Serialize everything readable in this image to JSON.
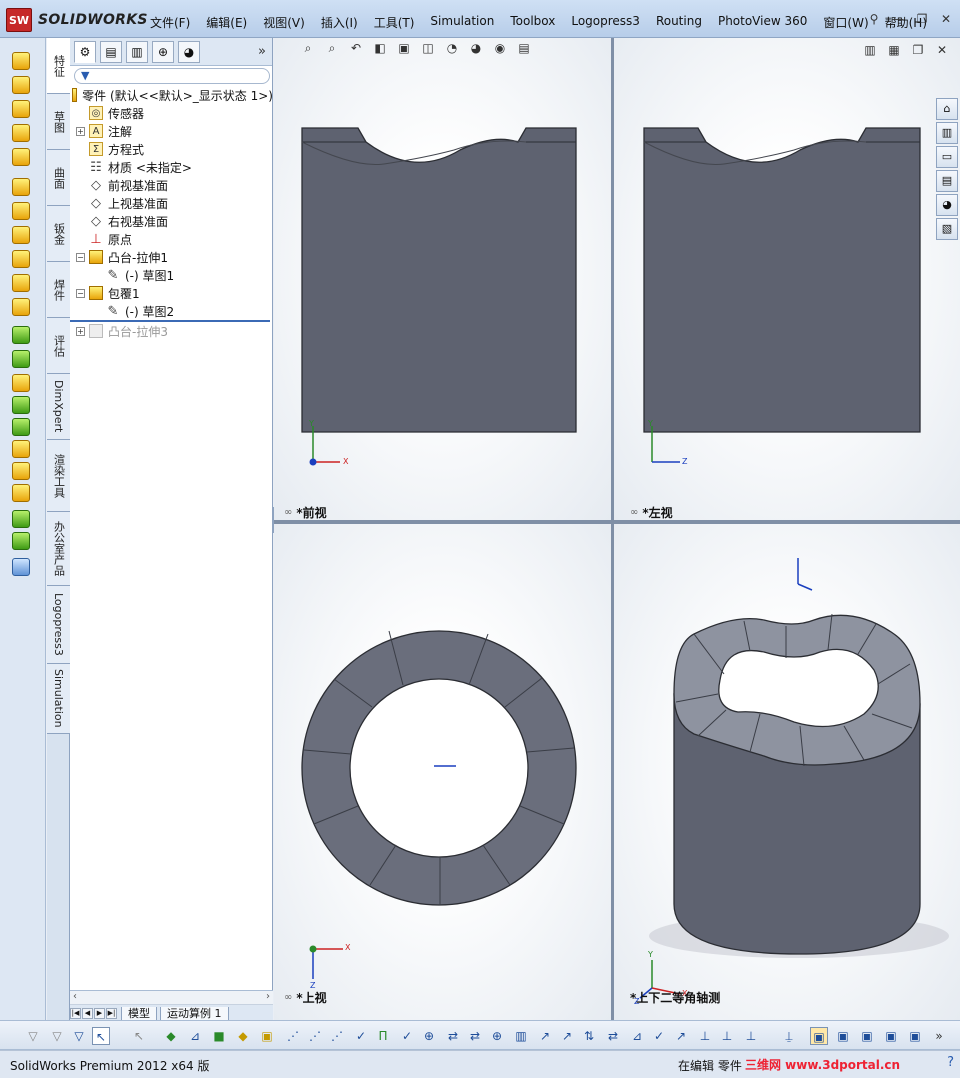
{
  "app": {
    "logo_badge": "SW",
    "logo_text": "SOLIDWORKS"
  },
  "menu": [
    "文件(F)",
    "编辑(E)",
    "视图(V)",
    "插入(I)",
    "工具(T)",
    "Simulation",
    "Toolbox",
    "Logopress3",
    "Routing",
    "PhotoView 360",
    "窗口(W)",
    "帮助(H)"
  ],
  "vertical_tabs": [
    "特征",
    "草图",
    "曲面",
    "钣金",
    "焊件",
    "评估",
    "DimXpert",
    "渲染工具",
    "办公室产品",
    "Logopress3",
    "Simulation"
  ],
  "tree": {
    "root": "零件 (默认<<默认>_显示状态 1>)",
    "items": [
      {
        "label": "传感器"
      },
      {
        "label": "注解"
      },
      {
        "label": "方程式"
      },
      {
        "label": "材质 <未指定>"
      },
      {
        "label": "前视基准面"
      },
      {
        "label": "上视基准面"
      },
      {
        "label": "右视基准面"
      },
      {
        "label": "原点"
      },
      {
        "label": "凸台-拉伸1"
      },
      {
        "label": "(-) 草图1"
      },
      {
        "label": "包覆1"
      },
      {
        "label": "(-) 草图2"
      },
      {
        "label": "凸台-拉伸3"
      }
    ]
  },
  "bottom_tabs": [
    "模型",
    "运动算例 1"
  ],
  "viewports": {
    "front": {
      "label": "*前视",
      "axes": {
        "y": "Y",
        "x": "X"
      }
    },
    "left": {
      "label": "*左视",
      "axes": {
        "y": "Y",
        "x": "Z"
      }
    },
    "top": {
      "label": "*上视",
      "axes": {
        "x": "X",
        "z": "Z"
      }
    },
    "iso": {
      "label": "*上下二等角轴测",
      "axes": {
        "y": "Y",
        "x": "X",
        "z": "Z"
      }
    }
  },
  "status": {
    "text": "SolidWorks Premium 2012 x64 版",
    "editing": "在编辑 零件",
    "watermark": "三维网 www.3dportal.cn"
  },
  "colors": {
    "model": "#5e6270",
    "model_dark": "#4b4f5c",
    "accent": "#2a5db0"
  }
}
